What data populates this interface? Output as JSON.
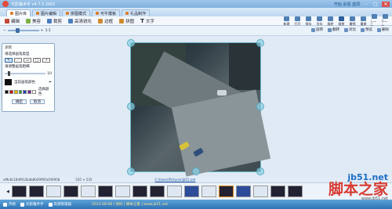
{
  "window": {
    "title": "光影魔术手 v4.7.5.2001",
    "link_help": "开始 反馈 选项",
    "min": "–",
    "max": "□",
    "close": "✕"
  },
  "tabs": [
    {
      "label": "图片库"
    },
    {
      "label": "图片编辑"
    },
    {
      "label": "拼图模式"
    },
    {
      "label": "可牛模板"
    },
    {
      "label": "礼品制作"
    }
  ],
  "toolbar": [
    {
      "label": "编辑",
      "color": "#c24c39"
    },
    {
      "label": "美容",
      "color": "#7db042"
    },
    {
      "label": "裁剪",
      "color": "#4a7ec1"
    },
    {
      "label": "高清锐化",
      "color": "#4a7ec1"
    },
    {
      "label": "边框",
      "color": "#cf8a2f"
    },
    {
      "label": "拼图",
      "color": "#cf8a2f"
    },
    {
      "label": "文字",
      "color": "#333333"
    }
  ],
  "right_tools": [
    "新建",
    "打开",
    "保存",
    "另存",
    "旋转",
    "裁剪",
    "撤销",
    "重做",
    "上一张",
    "下一张"
  ],
  "subbar": {
    "zoom_text": "1:1",
    "right": [
      "旋转",
      "翻转",
      "对比",
      "预览",
      "删除"
    ]
  },
  "panel": {
    "header": "涂鸦",
    "shape_label": "请选择画笔类型",
    "size_label": "请调整画笔粗细",
    "size_value": "10",
    "color_label": "当前画笔颜色",
    "more_label": "选择颜色",
    "ok": "确定",
    "cancel": "取消",
    "colors": [
      "#000000",
      "#cc0000",
      "#e6c200",
      "#2a9e2a",
      "#1c3fbf",
      "#7a1fa2",
      "#ffffff"
    ]
  },
  "info": {
    "name": "ef9c6c1849f12b4b8029f9f2e5f4958",
    "size": "535 × 535",
    "path": "C:\\Users\\Pictures\\jb51.net"
  },
  "taskbar": [
    {
      "label": "开始"
    },
    {
      "label": "光影魔术手"
    },
    {
      "label": "资源管理器"
    }
  ],
  "taskbar_status": "2011-06-08 | 你好 | 脚本之家 | www.jb51.net",
  "watermark": {
    "a": "jb51.net",
    "b": "脚本之家",
    "c": "www.jb51.net"
  }
}
